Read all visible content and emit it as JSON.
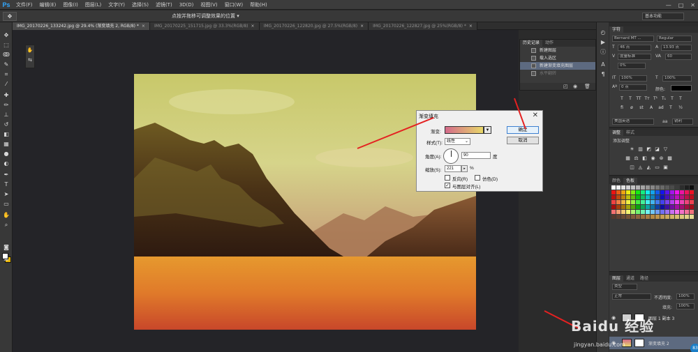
{
  "app": {
    "logo": "Ps",
    "menu": [
      "文件(F)",
      "编辑(E)",
      "图像(I)",
      "图层(L)",
      "文字(Y)",
      "选择(S)",
      "滤镜(T)",
      "3D(D)",
      "视图(V)",
      "窗口(W)",
      "帮助(H)"
    ],
    "window_controls": [
      "—",
      "□",
      "✕"
    ]
  },
  "options_bar": {
    "hint": "点按并拖移可调整效果的位置 ▾",
    "workspace": "基本功能"
  },
  "tabs": [
    {
      "label": "IMG_20170226_133242.jpg @ 29.4% (渐变填充 2, RGB/8) *",
      "active": true
    },
    {
      "label": "IMG_20170225_151715.jpg @ 33.3%(RGB/8)",
      "active": false
    },
    {
      "label": "IMG_20170226_122820.jpg @ 27.5%(RGB/8)",
      "active": false
    },
    {
      "label": "IMG_20170226_122827.jpg @ 25%(RGB/8) *",
      "active": false
    }
  ],
  "history_panel": {
    "tabs": [
      "历史记录",
      "动作"
    ],
    "items": [
      {
        "label": "新建图层",
        "selected": false,
        "faded": false
      },
      {
        "label": "载入选区",
        "selected": false,
        "faded": false
      },
      {
        "label": "新建渐变填充图层",
        "selected": true,
        "faded": false
      },
      {
        "label": "水平翻转",
        "selected": false,
        "faded": true
      }
    ]
  },
  "dialog": {
    "title": "渐变填充",
    "close": "✕",
    "gradient_label": "渐变:",
    "style_label": "样式(T):",
    "style_value": "线性",
    "angle_label": "角度(A):",
    "angle_value": "90",
    "angle_unit": "度",
    "scale_label": "缩放(S):",
    "scale_value": "221",
    "scale_unit": "%",
    "reverse_label": "反向(R)",
    "dither_label": "仿色(D)",
    "align_label": "与图层对齐(L)",
    "ok": "确定",
    "cancel": "取消"
  },
  "character_panel": {
    "tab": "字符",
    "font_family": "Bernard MT ...",
    "font_style": "Regular",
    "size": "46 点",
    "leading": "13.93 点",
    "kerning": "度量标准",
    "tracking": "60",
    "vscale": "0%",
    "hscale_v": "100%",
    "hscale_h": "100%",
    "baseline": "0 点",
    "color_label": "颜色:",
    "lang": "美国英语",
    "aa": "锐利"
  },
  "adjustments_panel": {
    "tabs": [
      "调整",
      "样式"
    ],
    "title": "添加调整"
  },
  "swatch_panel": {
    "tabs": [
      "颜色",
      "色板"
    ]
  },
  "layers_panel": {
    "tabs": [
      "图层",
      "通道",
      "路径"
    ],
    "filter": "类型",
    "blend_mode": "正常",
    "opacity_label": "不透明度:",
    "opacity": "100%",
    "fill_label": "填充:",
    "fill": "100%",
    "layers": [
      {
        "name": "图层 1 副本 3",
        "selected": false
      },
      {
        "name": "渐变填充 2",
        "selected": true
      }
    ]
  },
  "watermark": {
    "text": "Baidu 经验",
    "sub": "jingyan.baidu.com",
    "badge": "83"
  },
  "colors": {
    "highlight": "#5d6a80",
    "arrow": "#e42121",
    "ps_blue": "#31a8ff"
  }
}
